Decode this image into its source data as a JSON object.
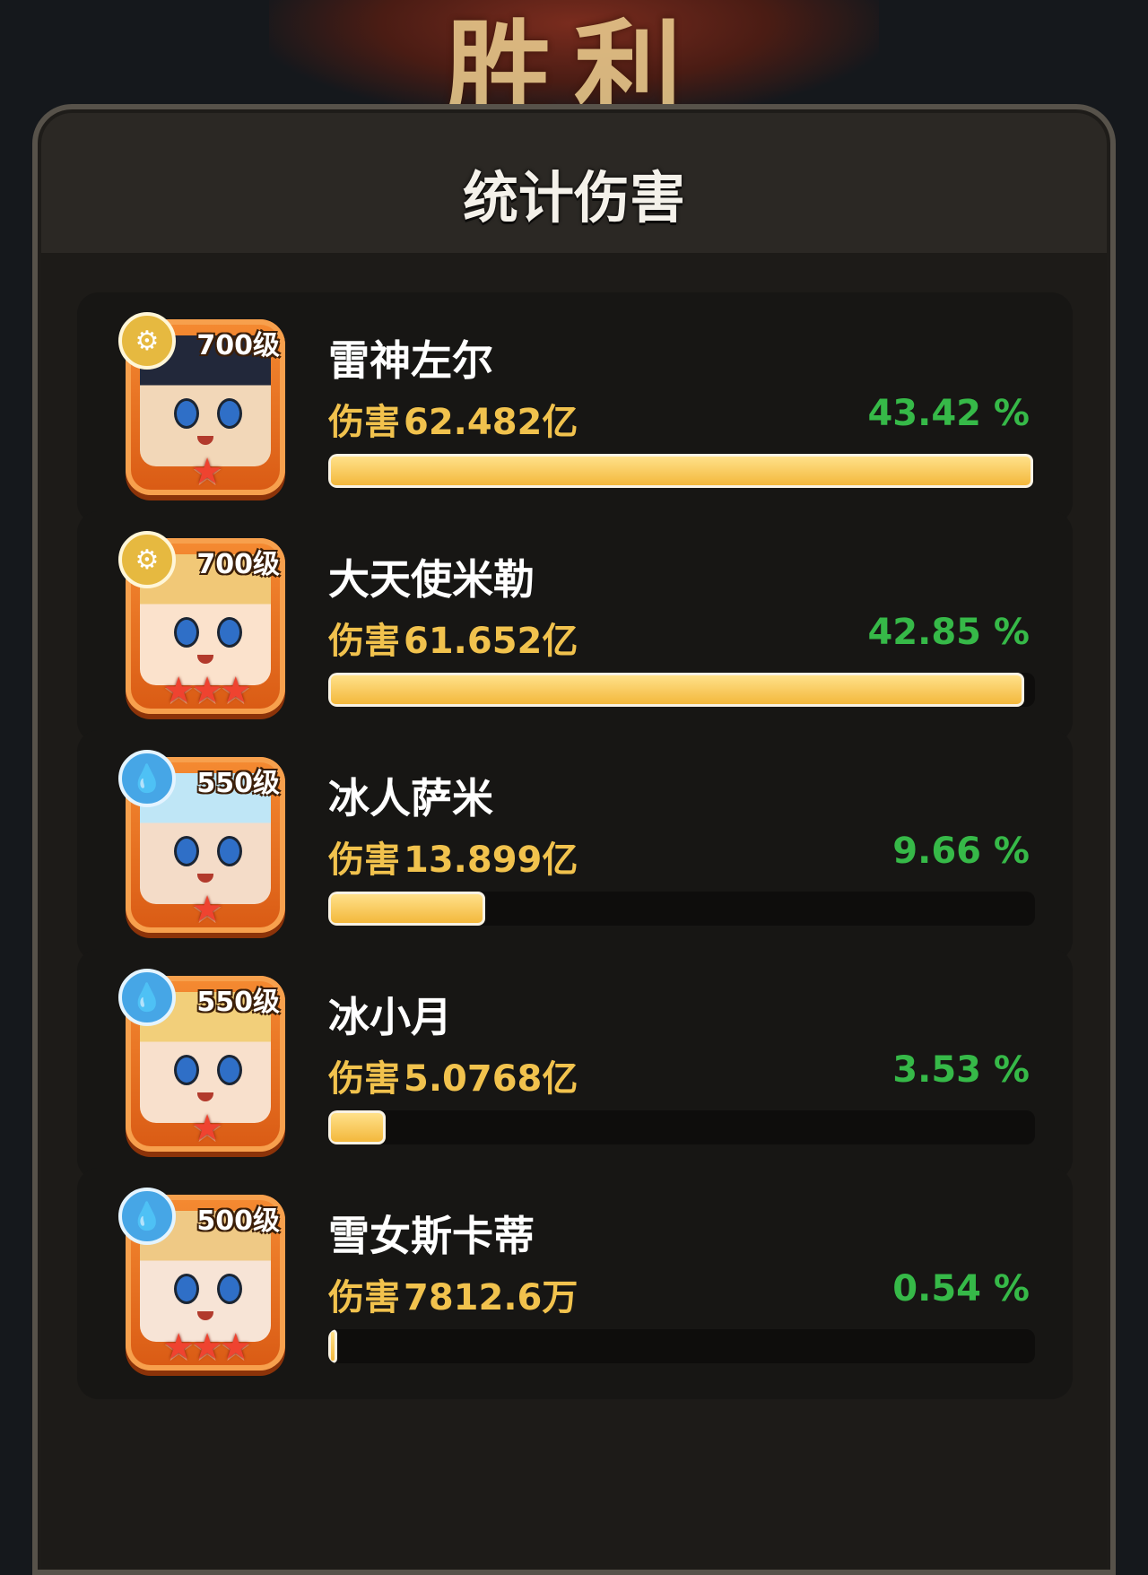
{
  "header": {
    "banner_text": "胜利"
  },
  "panel": {
    "title": "统计伤害"
  },
  "damage_label": "伤害",
  "heroes": [
    {
      "name": "雷神左尔",
      "level": "700级",
      "element": "gold",
      "element_icon": "⚙",
      "damage": "62.482亿",
      "percent": "43.42 %",
      "share": 0.4342,
      "stars": "★",
      "face_color": "#f2d7b8",
      "hair_color": "#22283a"
    },
    {
      "name": "大天使米勒",
      "level": "700级",
      "element": "gold",
      "element_icon": "⚙",
      "damage": "61.652亿",
      "percent": "42.85 %",
      "share": 0.4285,
      "stars": "★★★",
      "face_color": "#fbe2cc",
      "hair_color": "#f1c877"
    },
    {
      "name": "冰人萨米",
      "level": "550级",
      "element": "water",
      "element_icon": "💧",
      "damage": "13.899亿",
      "percent": "9.66 %",
      "share": 0.0966,
      "stars": "★",
      "face_color": "#f4dcc8",
      "hair_color": "#bfe6f6"
    },
    {
      "name": "冰小月",
      "level": "550级",
      "element": "water",
      "element_icon": "💧",
      "damage": "5.0768亿",
      "percent": "3.53 %",
      "share": 0.0353,
      "stars": "★",
      "face_color": "#f8e0cc",
      "hair_color": "#f2cf7a"
    },
    {
      "name": "雪女斯卡蒂",
      "level": "500级",
      "element": "water",
      "element_icon": "💧",
      "damage": "7812.6万",
      "percent": "0.54 %",
      "share": 0.0054,
      "stars": "★★★",
      "face_color": "#f7e4d6",
      "hair_color": "#efc985"
    }
  ]
}
